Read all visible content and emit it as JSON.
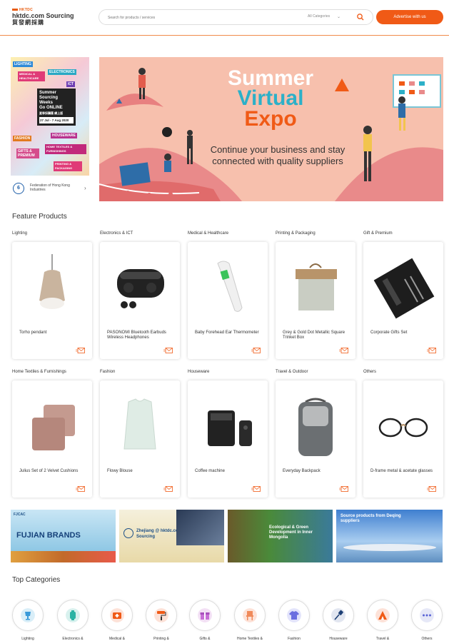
{
  "header": {
    "logo_top": "HKTDC",
    "logo_main": "hktdc.com Sourcing",
    "logo_cn": "貿發網採購",
    "search_placeholder": "Search for products / services",
    "category_select": "All Categories",
    "advertise_label": "Advertise with us"
  },
  "promo": {
    "tags": [
      "LIGHTING",
      "ELECTRONICS",
      "MEDICAL & HEALTHCARE",
      "ICT",
      "FASHION",
      "HOUSEWARE",
      "GIFTS & PREMIUM",
      "HOME TEXTILES & FURNISHINGS",
      "PRINTING & PACKAGING"
    ],
    "center_lines": [
      "Summer",
      "Sourcing",
      "Weeks",
      "Go ONLINE"
    ],
    "center_cn": "夏季採購匯 網上版",
    "dates": "27 Jul - 7 Aug 2020"
  },
  "federation": {
    "name": "Federation of Hong Kong Industries"
  },
  "banner": {
    "line1": "Summer",
    "line2": "Virtual",
    "line3": "Expo",
    "subtitle": "Continue your business and stay connected with quality suppliers"
  },
  "feature": {
    "title": "Feature Products",
    "rows": [
      [
        {
          "category": "Lighting",
          "product": "Torho pendant"
        },
        {
          "category": "Electronics & ICT",
          "product": "PASONOMI Bluetooth Earbuds Wireless Headphones"
        },
        {
          "category": "Medical & Healthcare",
          "product": "Baby Forehead Ear Thermometer"
        },
        {
          "category": "Printing & Packaging",
          "product": "Grey & Gold Dot Metallic Square Trinket Box"
        },
        {
          "category": "Gift & Premium",
          "product": "Corporate Gifts Set"
        }
      ],
      [
        {
          "category": "Home Textiles & Furnishings",
          "product": "Julius Set of 2 Velvet Cushions"
        },
        {
          "category": "Fashion",
          "product": "Flowy Blouse"
        },
        {
          "category": "Houseware",
          "product": "Coffee machine"
        },
        {
          "category": "Travel & Outdoor",
          "product": "Everyday Backpack"
        },
        {
          "category": "Others",
          "product": "D-frame metal & acetate glasses"
        }
      ]
    ]
  },
  "promos": [
    {
      "logo": "FJCAC",
      "text": "FUJIAN BRANDS"
    },
    {
      "text": "Zhejiang @ hktdc.com Sourcing"
    },
    {
      "text": "Ecological & Green Development in Inner Mongolia"
    },
    {
      "text": "Source products from Deqing suppliers"
    }
  ],
  "top_categories": {
    "title": "Top Categories",
    "items": [
      "Lighting",
      "Electronics &",
      "Medical &",
      "Printing &",
      "Gifts &",
      "Home Textiles &",
      "Fashion",
      "Houseware",
      "Travel &",
      "Others"
    ]
  }
}
